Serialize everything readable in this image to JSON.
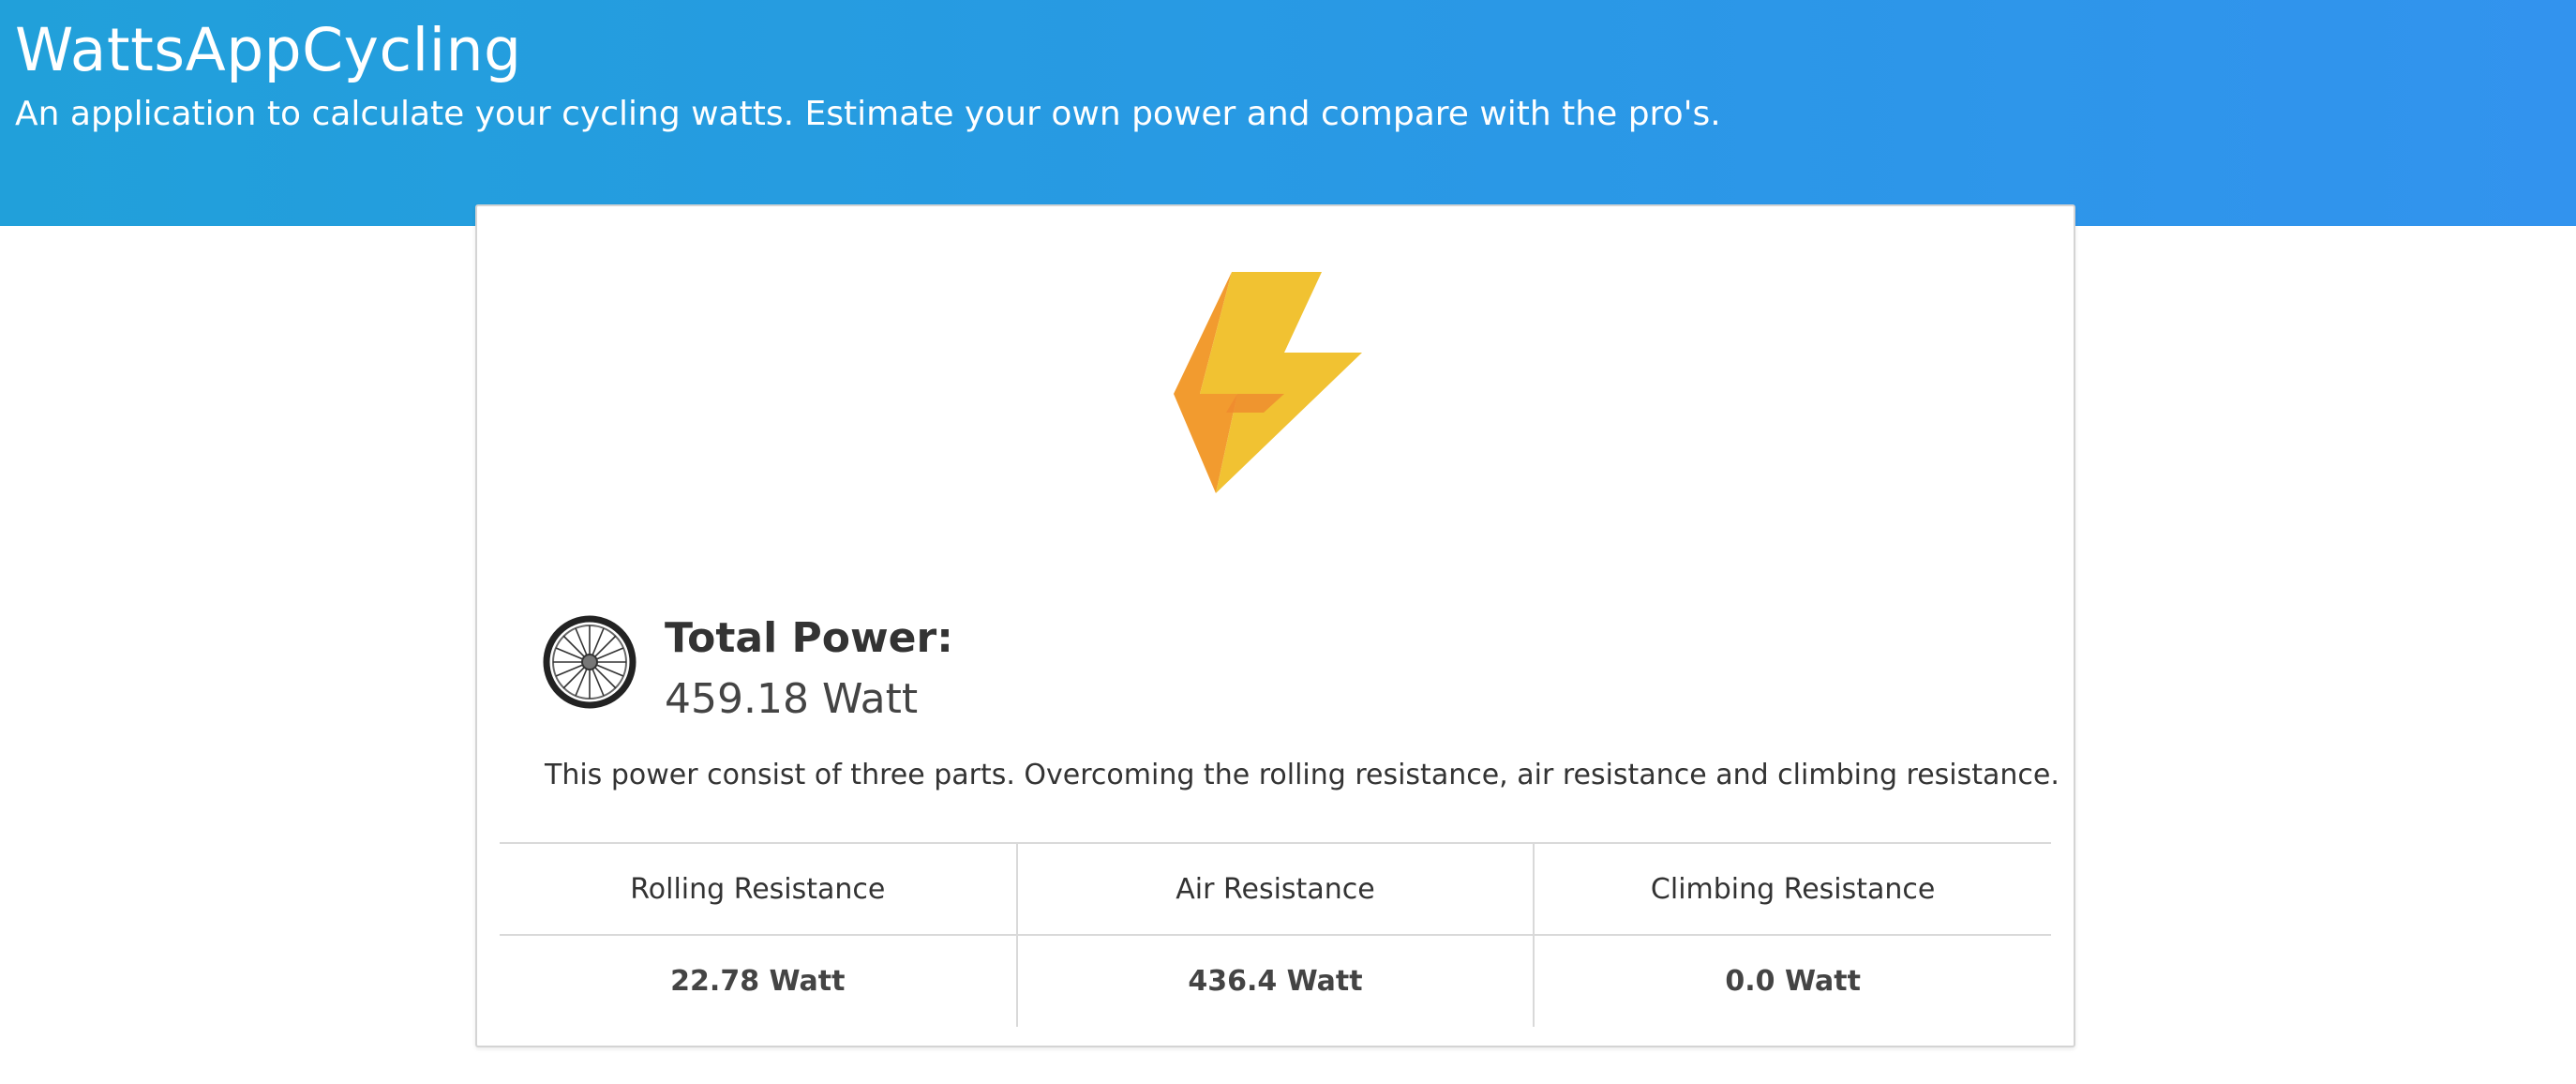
{
  "header": {
    "title": "WattsAppCycling",
    "subtitle": "An application to calculate your cycling watts. Estimate your own power and compare with the pro's."
  },
  "result": {
    "icons": {
      "hero": "lightning-bolt-icon",
      "power": "bicycle-wheel-icon"
    },
    "total_label": "Total Power:",
    "total_value": "459.18 Watt",
    "description": "This power consist of three parts. Overcoming the rolling resistance, air resistance and climbing resistance.",
    "breakdown": {
      "headers": [
        "Rolling Resistance",
        "Air Resistance",
        "Climbing Resistance"
      ],
      "values": [
        "22.78 Watt",
        "436.4 Watt",
        "0.0 Watt"
      ]
    }
  },
  "colors": {
    "header_gradient_start": "#21a0da",
    "header_gradient_end": "#3293ee",
    "bolt_orange": "#f29b2f",
    "bolt_yellow": "#f1c232"
  }
}
